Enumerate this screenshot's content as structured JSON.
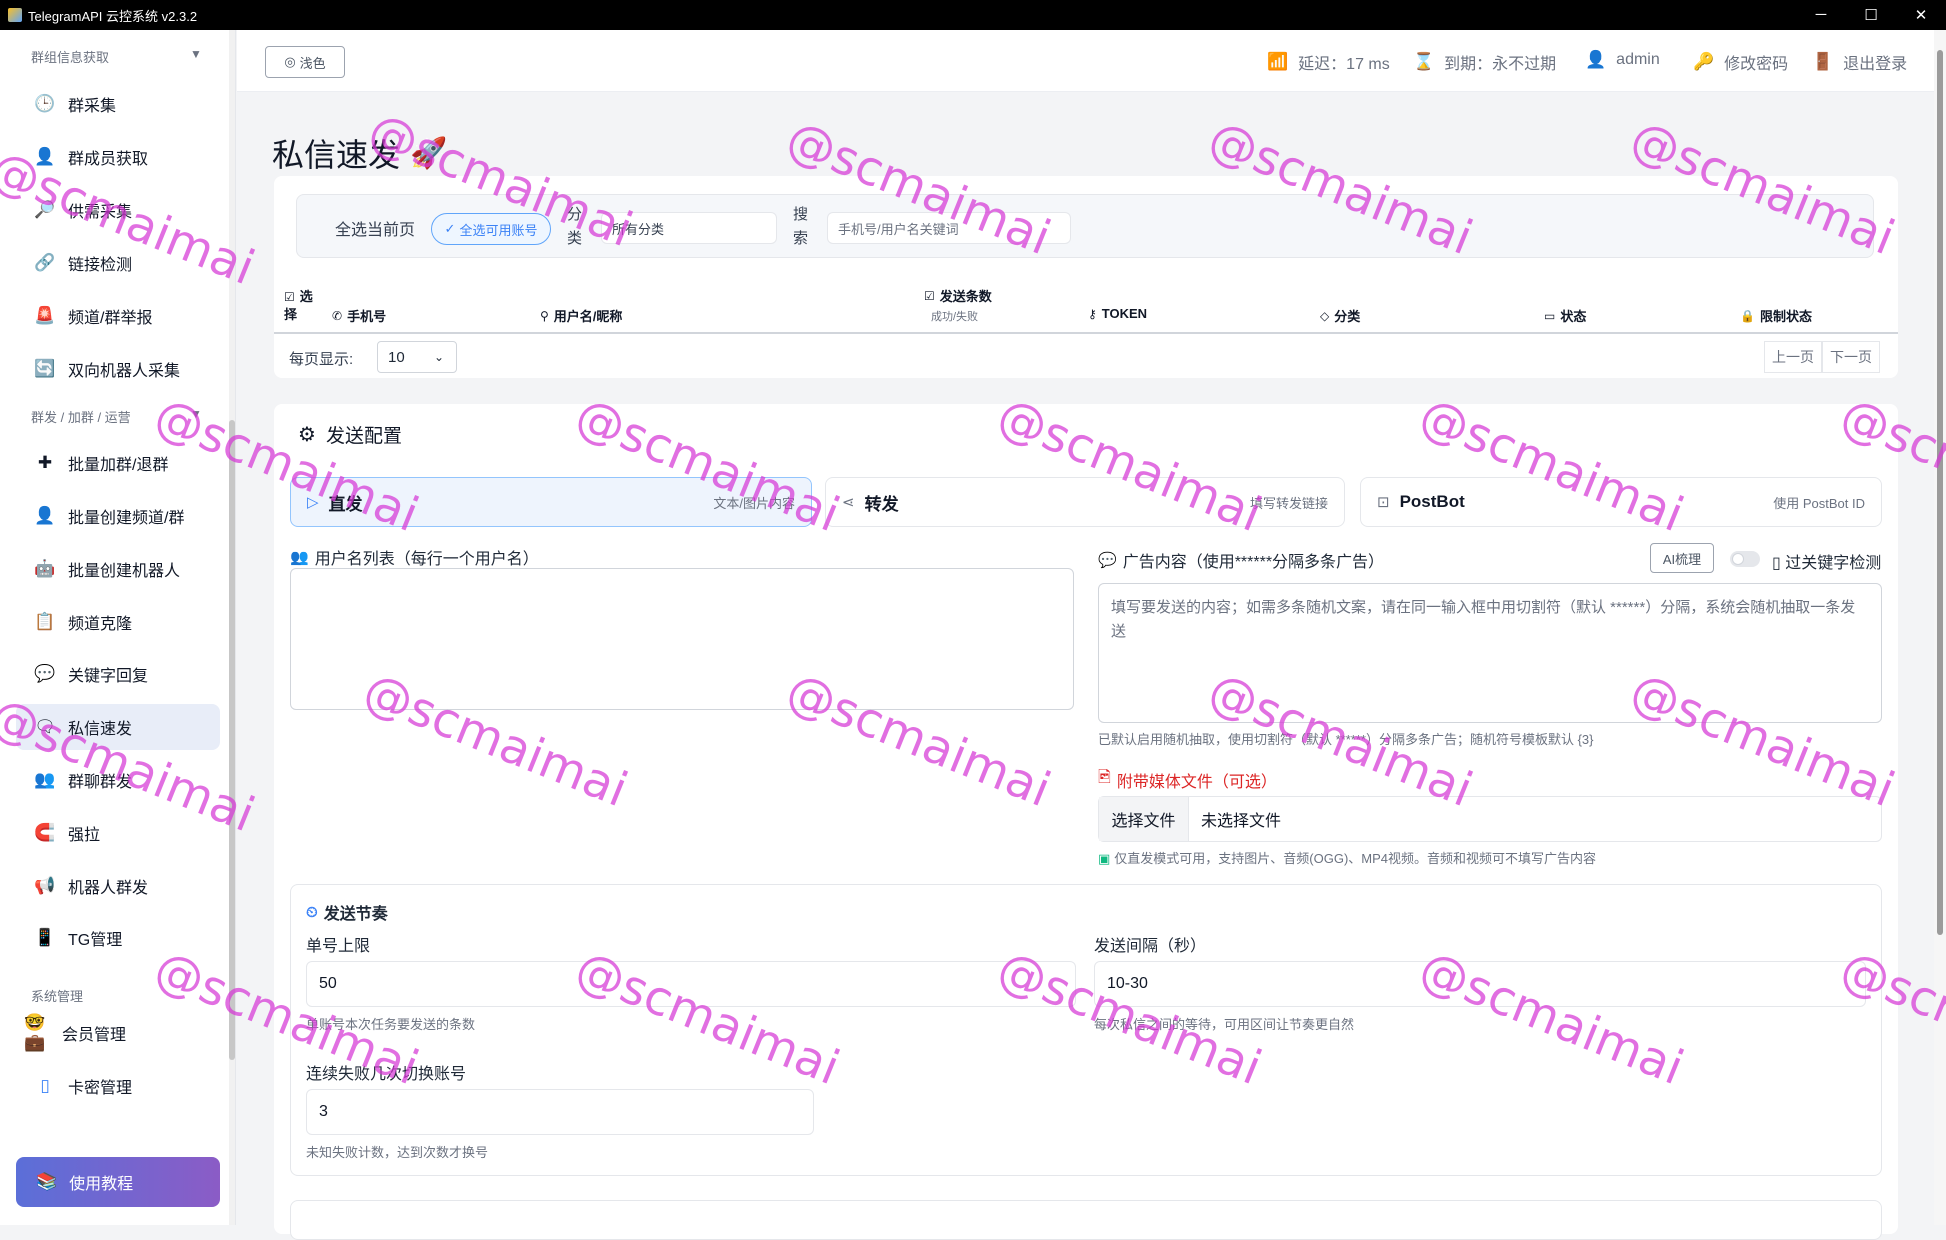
{
  "window": {
    "title": "TelegramAPI 云控系统 v2.3.2",
    "controls": [
      "─",
      "☐",
      "✕"
    ]
  },
  "sidebar": {
    "sections": [
      {
        "title": "群组信息获取",
        "items": [
          {
            "label": "群采集",
            "icon": "clock-icon",
            "glyph": "🕒"
          },
          {
            "label": "群成员获取",
            "icon": "user-icon",
            "glyph": "👤"
          },
          {
            "label": "供需采集",
            "icon": "search-icon",
            "glyph": "🔎"
          },
          {
            "label": "链接检测",
            "icon": "link-icon",
            "glyph": "🔗"
          },
          {
            "label": "频道/群举报",
            "icon": "alarm-icon",
            "glyph": "🚨"
          },
          {
            "label": "双向机器人采集",
            "icon": "refresh-icon",
            "glyph": "🔄"
          }
        ]
      },
      {
        "title": "群发 / 加群 / 运营",
        "items": [
          {
            "label": "批量加群/退群",
            "icon": "plus-icon",
            "glyph": "✚"
          },
          {
            "label": "批量创建频道/群",
            "icon": "user-add-icon",
            "glyph": "👤"
          },
          {
            "label": "批量创建机器人",
            "icon": "robot-icon",
            "glyph": "🤖"
          },
          {
            "label": "频道克隆",
            "icon": "clipboard-icon",
            "glyph": "📋"
          },
          {
            "label": "关键字回复",
            "icon": "chat-icon",
            "glyph": "💬"
          },
          {
            "label": "私信速发",
            "icon": "message-icon",
            "glyph": "🗨"
          },
          {
            "label": "群聊群发",
            "icon": "group-icon",
            "glyph": "👥"
          },
          {
            "label": "强拉",
            "icon": "magnet-icon",
            "glyph": "🧲"
          },
          {
            "label": "机器人群发",
            "icon": "megaphone-icon",
            "glyph": "📢"
          },
          {
            "label": "TG管理",
            "icon": "phone-icon",
            "glyph": "📱"
          }
        ]
      },
      {
        "title": "系统管理",
        "items": [
          {
            "label": "会员管理",
            "icon": "member-icon",
            "glyph": "🤓💼"
          },
          {
            "label": "卡密管理",
            "icon": "card-icon",
            "glyph": "▯"
          }
        ]
      }
    ],
    "tutorial": {
      "label": "使用教程",
      "glyph": "📚"
    }
  },
  "topbar": {
    "theme_button": "浅色",
    "latency": "延迟：17 ms",
    "expiry": "到期：永不过期",
    "user": "admin",
    "change_password": "修改密码",
    "logout": "退出登录"
  },
  "page": {
    "title": "私信速发",
    "title_emoji": "🚀"
  },
  "filter": {
    "select_page": "全选当前页",
    "select_available": "全选可用账号",
    "category_label": "分类",
    "category_value": "所有分类",
    "search_label": "搜索",
    "search_placeholder": "手机号/用户名关键词"
  },
  "table": {
    "columns": {
      "select": "选择",
      "phone": "手机号",
      "username": "用户名/昵称",
      "sent": "发送条数",
      "sent_sub": "成功/失败",
      "token": "TOKEN",
      "category": "分类",
      "status": "状态",
      "limit": "限制状态"
    }
  },
  "pager": {
    "label": "每页显示:",
    "page_size": "10",
    "prev": "上一页",
    "next": "下一页"
  },
  "config": {
    "title": "发送配置",
    "modes": [
      {
        "label": "直发",
        "hint": "文本/图片内容"
      },
      {
        "label": "转发",
        "hint": "填写转发链接"
      },
      {
        "label": "PostBot",
        "hint": "使用 PostBot ID"
      }
    ],
    "username_list_label": "用户名列表（每行一个用户名）",
    "ad_label": "广告内容（使用******分隔多条广告）",
    "ai_button": "AI梳理",
    "skip_keyword": "过关键字检测",
    "ad_placeholder": "填写要发送的内容；如需多条随机文案，请在同一输入框中用切割符（默认 ******）分隔，系统会随机抽取一条发送",
    "ad_hint": "已默认启用随机抽取，使用切割符（默认 ******）分隔多条广告；随机符号模板默认 {3}",
    "media_label": "附带媒体文件（可选）",
    "file_button": "选择文件",
    "file_name": "未选择文件",
    "media_hint": "仅直发模式可用，支持图片、音频(OGG)、MP4视频。音频和视频可不填写广告内容"
  },
  "rhythm": {
    "title": "发送节奏",
    "limit_label": "单号上限",
    "limit_value": "50",
    "limit_hint": "单账号本次任务要发送的条数",
    "interval_label": "发送间隔（秒）",
    "interval_value": "10-30",
    "interval_hint": "每次私信之间的等待，可用区间让节奏更自然",
    "fail_label": "连续失败几次切换账号",
    "fail_value": "3",
    "fail_hint": "未知失败计数，达到次数才换号"
  },
  "watermark": "@scmaimai"
}
